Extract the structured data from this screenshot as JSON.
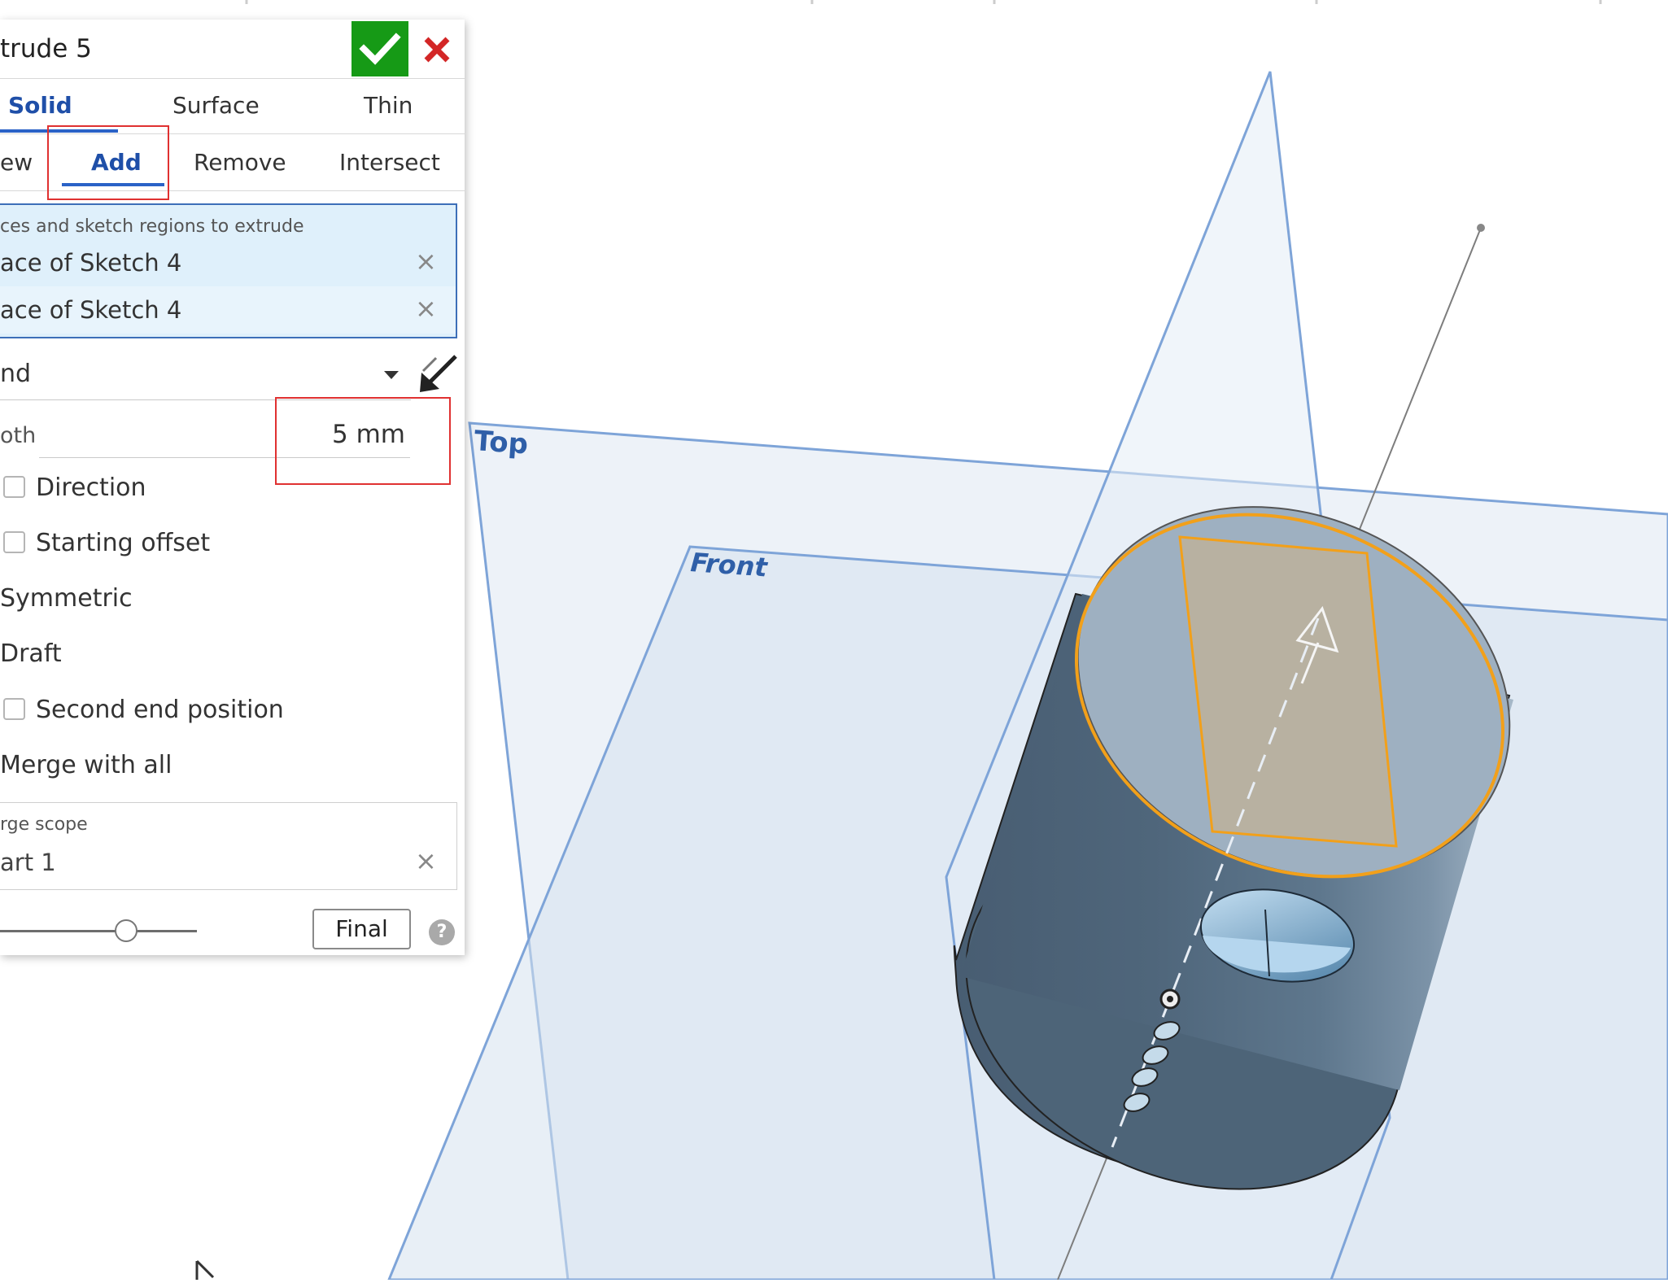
{
  "dialog": {
    "title": "trude 5",
    "accept_icon": "check-icon",
    "cancel_icon": "close-icon",
    "accept_color": "#169a16",
    "cancel_color": "#d32626"
  },
  "body_type_tabs": [
    {
      "label": "Solid",
      "active": true
    },
    {
      "label": "Surface",
      "active": false
    },
    {
      "label": "Thin",
      "active": false
    }
  ],
  "operation_tabs": [
    {
      "label": "ew",
      "active": false
    },
    {
      "label": "Add",
      "active": true
    },
    {
      "label": "Remove",
      "active": false
    },
    {
      "label": "Intersect",
      "active": false
    }
  ],
  "entities": {
    "title": "ces and sketch regions to extrude",
    "items": [
      "ace of Sketch 4",
      "ace of Sketch 4"
    ]
  },
  "end_type": {
    "value": "nd"
  },
  "depth": {
    "label": "oth",
    "value": "5 mm"
  },
  "options": {
    "direction": "Direction",
    "starting_offset": "Starting offset",
    "symmetric": "Symmetric",
    "draft": "Draft",
    "second_end_position": "Second end position",
    "merge_with_all": "Merge with all"
  },
  "merge_scope": {
    "title": "rge scope",
    "value": "art 1"
  },
  "footer": {
    "final_label": "Final",
    "help_label": "?",
    "slider_value": 0.6
  },
  "viewport": {
    "planes": {
      "top": "Top",
      "front": "Front"
    },
    "highlight_color": "#f2a01a",
    "plane_color": "#5b8fd6"
  }
}
